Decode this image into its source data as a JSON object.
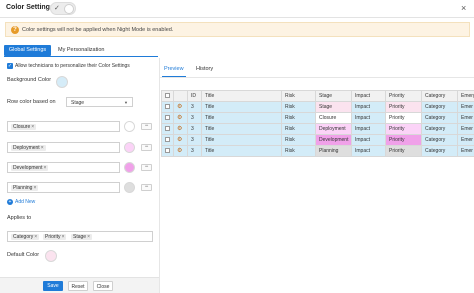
{
  "window": {
    "title": "Color Settings",
    "night_mode_check": "✓",
    "close": "×"
  },
  "warning": {
    "icon": "?",
    "text": "Color settings will not be applied when Night Mode is enabled."
  },
  "tabs": {
    "global": "Global Settings",
    "personal": "My Personalization"
  },
  "allow": {
    "label": "Allow technicians to personalize their Color Settings",
    "checked": true
  },
  "background": {
    "label": "Background Color",
    "color": "#d5ecf8"
  },
  "row_color": {
    "label": "Row color based on",
    "value": "Stage",
    "arrow": "▼"
  },
  "rules": [
    {
      "chip": "Closure",
      "color": "#ffffff"
    },
    {
      "chip": "Deployment",
      "color": "#fbd3f7"
    },
    {
      "chip": "Development",
      "color": "#f0a1e9"
    },
    {
      "chip": "Planning",
      "color": "#dedede"
    }
  ],
  "remove_label": "−",
  "chip_x": "×",
  "add_new": {
    "plus": "+",
    "label": "Add New"
  },
  "applies_to": {
    "label": "Applies to",
    "chips": [
      "Category",
      "Priority",
      "Stage"
    ]
  },
  "default_color": {
    "label": "Default Color",
    "color": "#fbe3ef"
  },
  "footer": {
    "save": "Save",
    "reset": "Reset",
    "close": "Close"
  },
  "preview_tabs": {
    "preview": "Preview",
    "history": "History"
  },
  "table": {
    "headers": [
      "",
      "",
      "ID",
      "Title",
      "Risk",
      "Stage",
      "Impact",
      "Priority",
      "Category",
      "Emerg"
    ],
    "rows": [
      {
        "id": "3",
        "title": "Title",
        "risk": "Risk",
        "stage": "Stage",
        "impact": "Impact",
        "priority": "Priority",
        "category": "Category",
        "emerg": "Emer",
        "base": "#d3ecf8",
        "hl": "#fbe3ef"
      },
      {
        "id": "3",
        "title": "Title",
        "risk": "Risk",
        "stage": "Closure",
        "impact": "Impact",
        "priority": "Priority",
        "category": "Category",
        "emerg": "Emer",
        "base": "#d3ecf8",
        "hl": "#ffffff"
      },
      {
        "id": "3",
        "title": "Title",
        "risk": "Risk",
        "stage": "Deployment",
        "impact": "Impact",
        "priority": "Priority",
        "category": "Category",
        "emerg": "Emer",
        "base": "#d3ecf8",
        "hl": "#fbd3f7"
      },
      {
        "id": "3",
        "title": "Title",
        "risk": "Risk",
        "stage": "Development",
        "impact": "Impact",
        "priority": "Priority",
        "category": "Category",
        "emerg": "Emer",
        "base": "#d3ecf8",
        "hl": "#f0a1e9"
      },
      {
        "id": "3",
        "title": "Title",
        "risk": "Risk",
        "stage": "Planning",
        "impact": "Impact",
        "priority": "Priority",
        "category": "Category",
        "emerg": "Emer",
        "base": "#d3ecf8",
        "hl": "#dedede"
      }
    ]
  },
  "colors": {
    "accent": "#1f7bd8",
    "warning_bg": "#fdf3e3",
    "warning_icon": "#e69b2a"
  }
}
